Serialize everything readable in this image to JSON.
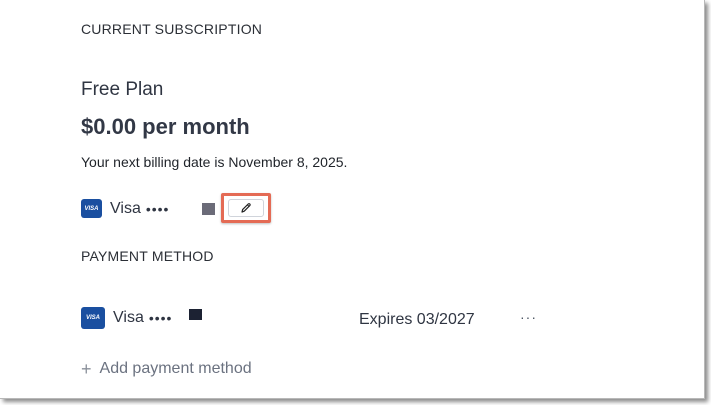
{
  "subscription": {
    "heading": "CURRENT SUBSCRIPTION",
    "plan_name": "Free Plan",
    "price": "$0.00 per month",
    "billing_note": "Your next billing date is November 8, 2025.",
    "card": {
      "badge": "VISA",
      "brand": "Visa",
      "dots": "••••"
    },
    "edit_icon": "pencil-icon"
  },
  "payment_method": {
    "heading": "PAYMENT METHOD",
    "card": {
      "badge": "VISA",
      "brand": "Visa",
      "dots": "••••",
      "expires": "Expires 03/2027"
    },
    "more_label": "···",
    "add_label": "Add payment method",
    "add_icon": "plus-icon"
  },
  "colors": {
    "visa_blue": "#1a4fa0",
    "highlight": "#e46b55"
  }
}
